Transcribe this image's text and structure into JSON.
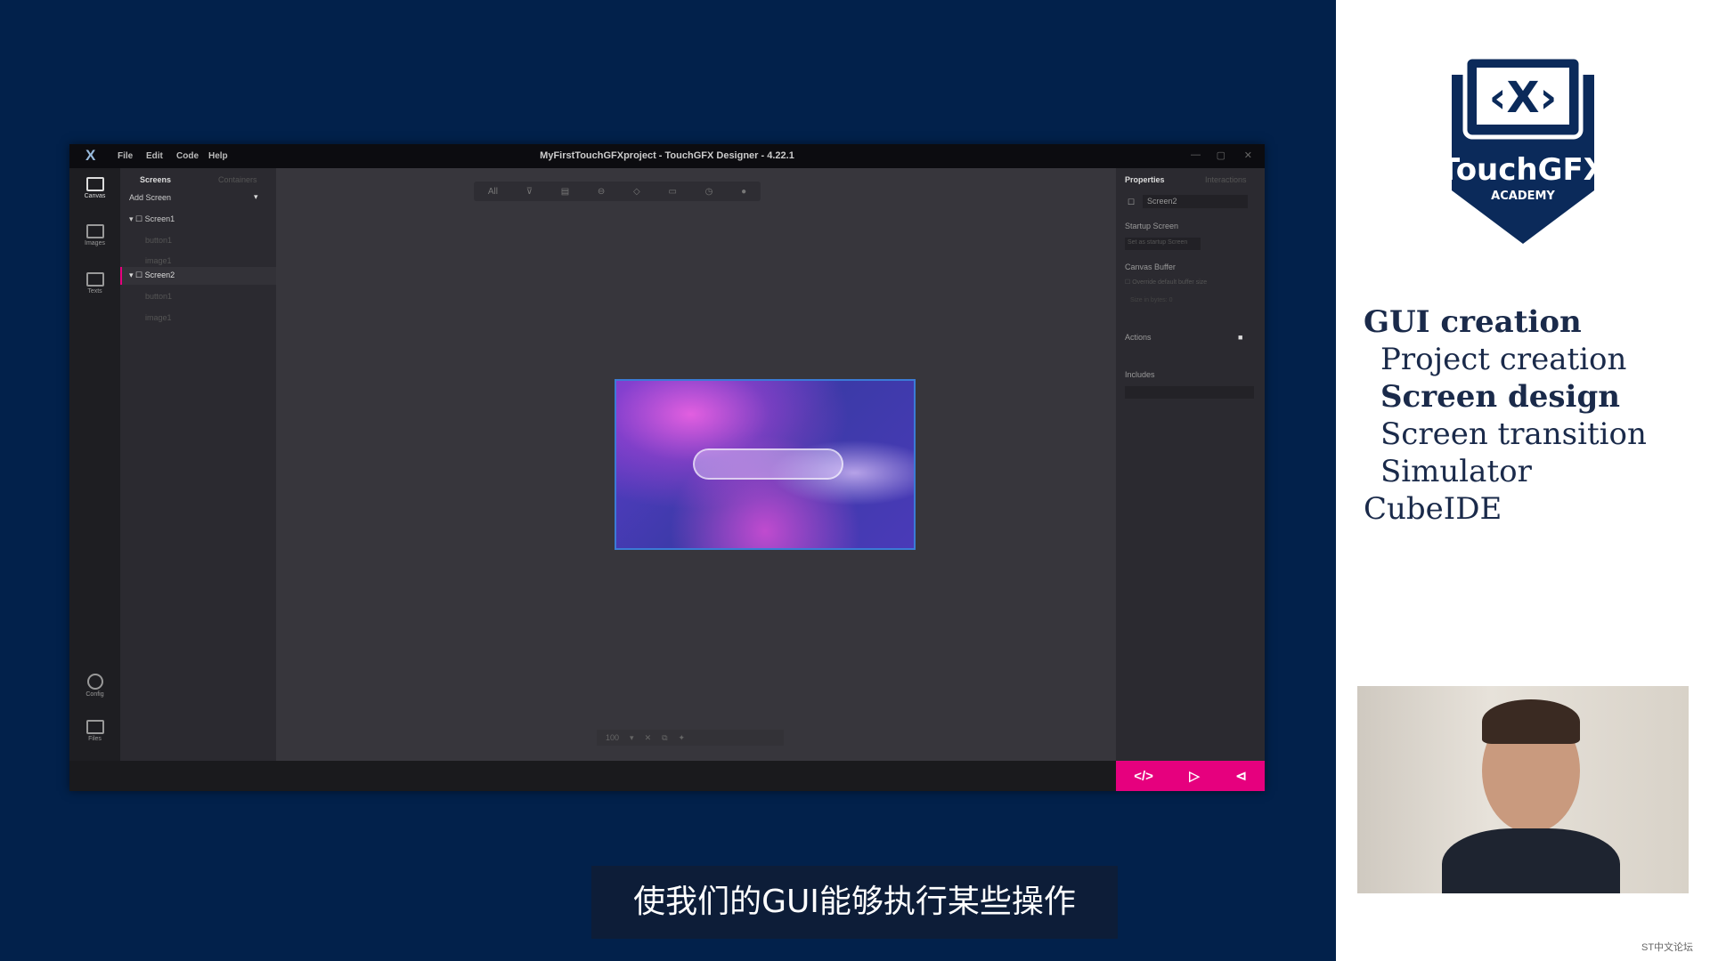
{
  "window": {
    "title": "MyFirstTouchGFXproject - TouchGFX Designer - 4.22.1",
    "menu": [
      "File",
      "Edit",
      "Code",
      "Help"
    ]
  },
  "rail": [
    {
      "label": "Canvas",
      "icon": "canvas-icon"
    },
    {
      "label": "Images",
      "icon": "images-icon"
    },
    {
      "label": "Texts",
      "icon": "texts-icon"
    },
    {
      "label": "Config",
      "icon": "config-icon"
    },
    {
      "label": "Files",
      "icon": "files-icon"
    }
  ],
  "screens_panel": {
    "tabs": [
      "Screens",
      "Containers"
    ],
    "add_screen": "Add Screen",
    "tree": [
      {
        "name": "Screen1",
        "children": [
          "button1",
          "image1"
        ]
      },
      {
        "name": "Screen2",
        "children": [
          "button1",
          "image1"
        ]
      }
    ]
  },
  "canvas": {
    "toolbar": [
      "All"
    ],
    "zoom": "100"
  },
  "properties": {
    "tabs": [
      "Properties",
      "Interactions"
    ],
    "name": "Screen2",
    "startup_label": "Startup Screen",
    "startup_button": "Set as startup Screen",
    "canvas_buffer": "Canvas Buffer",
    "override": "Override default buffer size",
    "size": "Size in bytes: 0",
    "actions": "Actions",
    "includes": "Includes"
  },
  "accent": "#e6007e",
  "course": {
    "logo_text": "TouchGFX",
    "logo_sub": "ACADEMY",
    "items": [
      {
        "text": "GUI creation",
        "level": 0,
        "bold": true
      },
      {
        "text": "Project creation",
        "level": 1
      },
      {
        "text": "Screen design",
        "level": 1,
        "bold": true
      },
      {
        "text": "Screen transition",
        "level": 1
      },
      {
        "text": "Simulator",
        "level": 1
      },
      {
        "text": "CubeIDE",
        "level": 0
      }
    ]
  },
  "subtitle": "使我们的GUI能够执行某些操作",
  "watermark": "ST中文论坛"
}
